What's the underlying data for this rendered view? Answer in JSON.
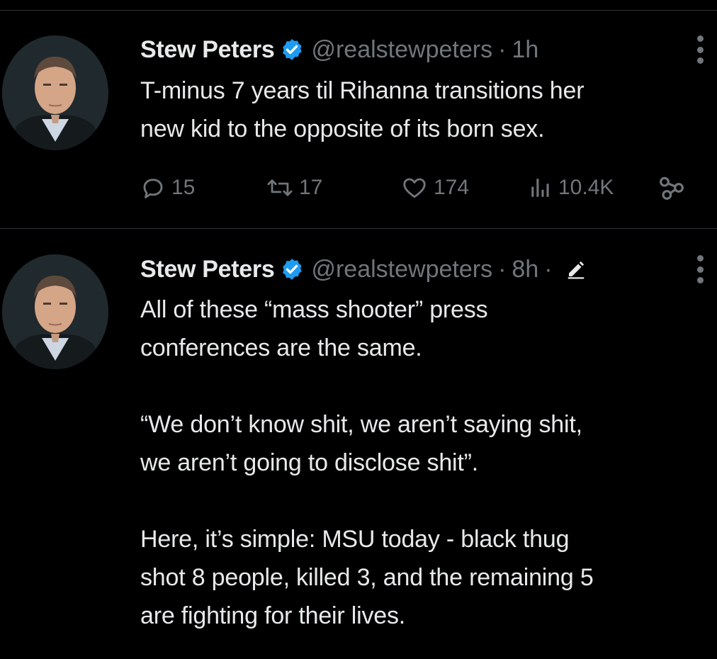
{
  "tweets": [
    {
      "author_name": "Stew Peters",
      "handle": "@realstewpeters",
      "separator": "·",
      "time": "1h",
      "text": "T-minus 7 years til Rihanna transitions her\nnew kid to the opposite of its born sex.",
      "stats": {
        "replies": "15",
        "retweets": "17",
        "likes": "174",
        "views": "10.4K"
      }
    },
    {
      "author_name": "Stew Peters",
      "handle": "@realstewpeters",
      "separator": "·",
      "time": "8h",
      "edited_separator": "·",
      "text": "All of these “mass shooter” press\nconferences are the same.\n\n“We don’t know shit, we aren’t saying shit,\nwe aren’t going to disclose shit”.\n\nHere, it’s simple: MSU today - black thug\nshot 8 people, killed 3, and the remaining 5\nare fighting for their lives."
    }
  ],
  "colors": {
    "background": "#000000",
    "text_primary": "#e7e9ea",
    "text_secondary": "#71767b",
    "verified_badge": "#1d9bf0",
    "divider": "#2f3336"
  },
  "icons": {
    "verified": "verified-badge-icon",
    "reply": "reply-icon",
    "retweet": "retweet-icon",
    "like": "heart-icon",
    "views": "views-bar-chart-icon",
    "share": "share-icon",
    "more": "more-options-icon",
    "edited": "edit-pencil-icon"
  }
}
